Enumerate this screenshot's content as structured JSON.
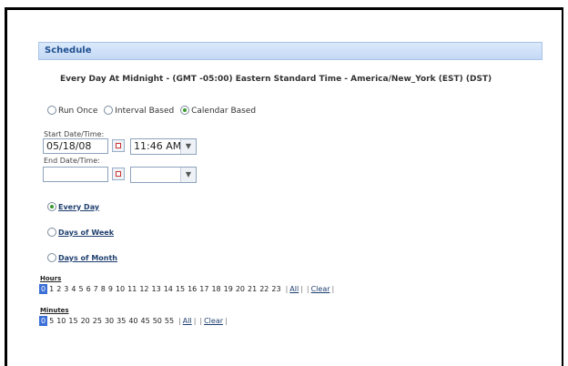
{
  "panel": {
    "title": "Schedule"
  },
  "summary": "Every Day At Midnight  - (GMT -05:00) Eastern Standard Time - America/New_York (EST) (DST)",
  "run_mode": {
    "options": [
      "Run Once",
      "Interval Based",
      "Calendar Based"
    ],
    "selected": "Calendar Based"
  },
  "start": {
    "label": "Start Date/Time:",
    "date": "05/18/08",
    "time": "11:46 AM"
  },
  "end": {
    "label": "End Date/Time:",
    "date": "",
    "time": ""
  },
  "frequency": {
    "options": [
      "Every Day",
      "Days of Week",
      "Days of Month"
    ],
    "selected": "Every Day"
  },
  "hours": {
    "label": "Hours",
    "values": [
      "0",
      "1",
      "2",
      "3",
      "4",
      "5",
      "6",
      "7",
      "8",
      "9",
      "10",
      "11",
      "12",
      "13",
      "14",
      "15",
      "16",
      "17",
      "18",
      "19",
      "20",
      "21",
      "22",
      "23"
    ],
    "selected": "0",
    "all_label": "All",
    "clear_label": "Clear"
  },
  "minutes": {
    "label": "Minutes",
    "values": [
      "0",
      "5",
      "10",
      "15",
      "20",
      "25",
      "30",
      "35",
      "40",
      "45",
      "50",
      "55"
    ],
    "selected": "0",
    "all_label": "All",
    "clear_label": "Clear"
  }
}
